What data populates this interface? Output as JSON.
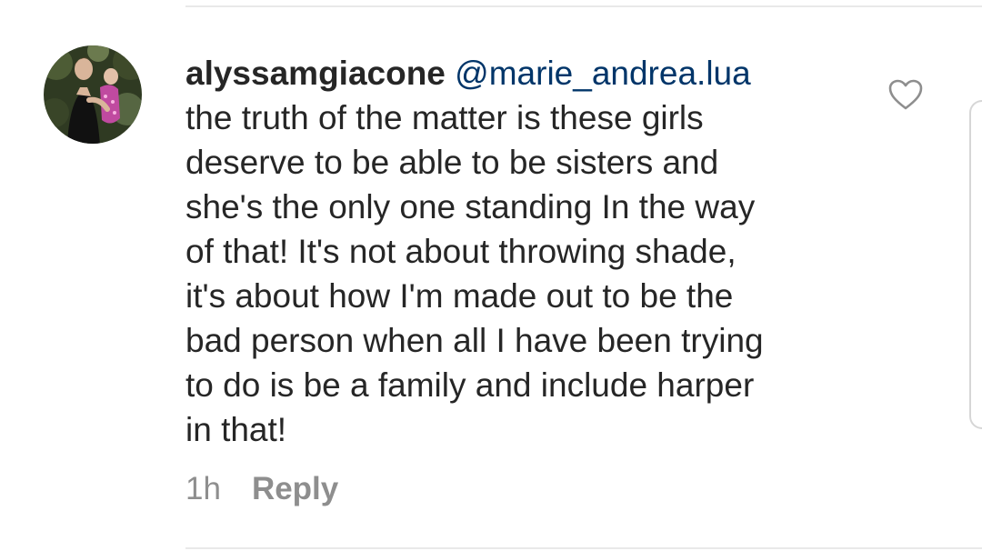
{
  "comment": {
    "username": "alyssamgiacone",
    "mention": "@marie_andrea.lua",
    "text": "the truth of the matter is these girls\ndeserve to be able to be sisters and\nshe's the only one standing In the way\nof that! It's not about throwing shade,\nit's about how I'm made out to be the\nbad person when all I have been trying\nto do is be a family and include harper\nin that!",
    "timestamp": "1h",
    "reply_label": "Reply"
  },
  "icons": {
    "like": "heart-outline-icon"
  },
  "colors": {
    "text": "#262626",
    "mention": "#003569",
    "muted": "#8e8e8e",
    "divider": "#e9e9e9"
  }
}
